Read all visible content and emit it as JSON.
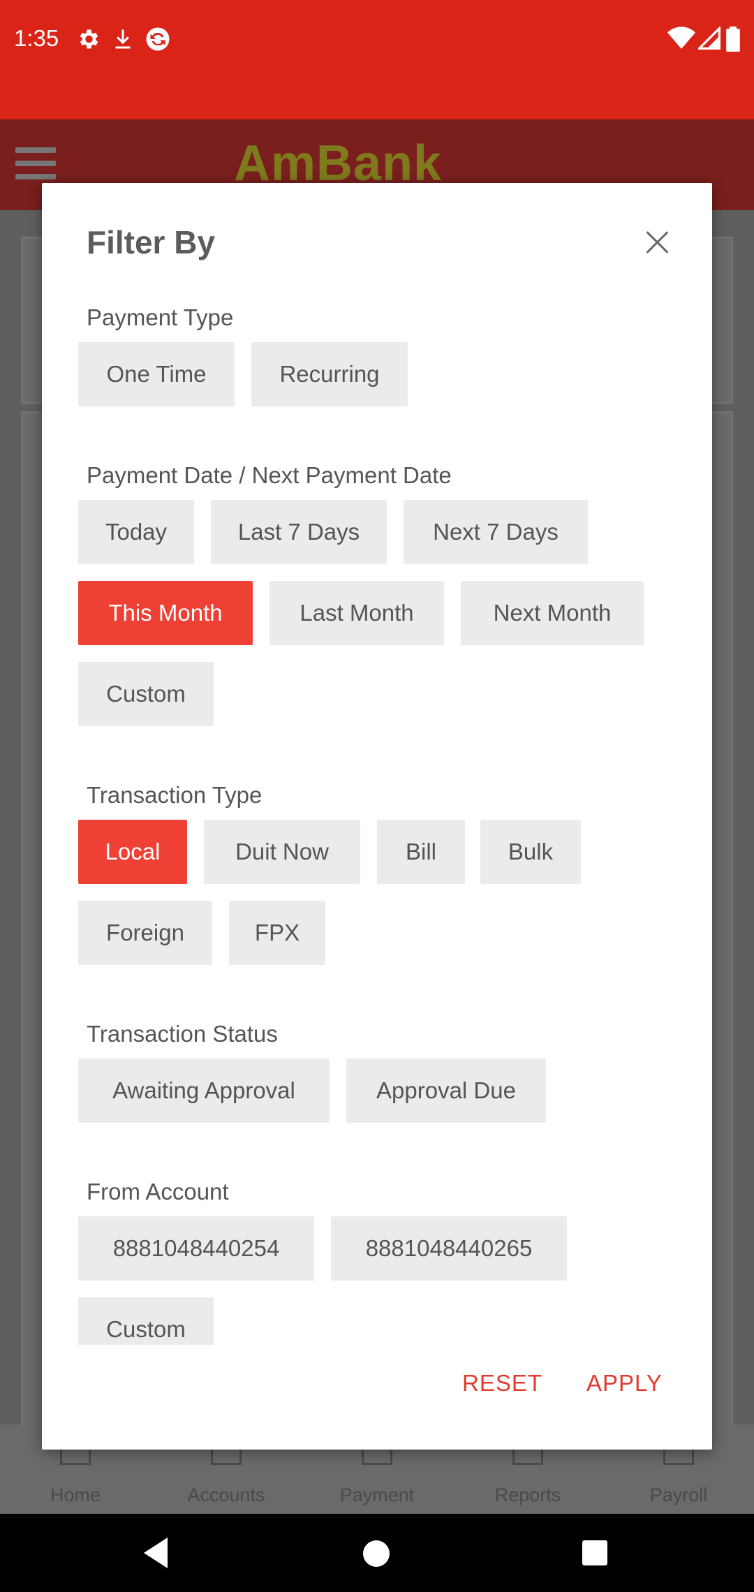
{
  "status_bar": {
    "time": "1:35",
    "icons": [
      "gear-icon",
      "download-icon",
      "sync-icon"
    ],
    "right_icons": [
      "wifi-icon",
      "signal-icon",
      "battery-icon"
    ]
  },
  "app_bar": {
    "logo_text": "AmBank"
  },
  "bottom_nav": {
    "items": [
      {
        "label": "Home",
        "icon": "home-icon"
      },
      {
        "label": "Accounts",
        "icon": "accounts-icon"
      },
      {
        "label": "Payment",
        "icon": "payment-icon"
      },
      {
        "label": "Reports",
        "icon": "reports-icon"
      },
      {
        "label": "Payroll",
        "icon": "payroll-icon"
      }
    ]
  },
  "dialog": {
    "title": "Filter By",
    "sections": {
      "payment_type": {
        "label": "Payment Type",
        "options": [
          "One Time",
          "Recurring"
        ]
      },
      "payment_date": {
        "label": "Payment Date / Next Payment Date",
        "options": [
          "Today",
          "Last 7 Days",
          "Next 7 Days",
          "This Month",
          "Last Month",
          "Next Month",
          "Custom"
        ],
        "selected": "This Month"
      },
      "transaction_type": {
        "label": "Transaction Type",
        "options": [
          "Local",
          "Duit Now",
          "Bill",
          "Bulk",
          "Foreign",
          "FPX"
        ],
        "selected": "Local"
      },
      "transaction_status": {
        "label": "Transaction Status",
        "options": [
          "Awaiting Approval",
          "Approval Due"
        ]
      },
      "from_account": {
        "label": "From Account",
        "options": [
          "8881048440254",
          "8881048440265",
          "Custom"
        ]
      }
    },
    "actions": {
      "reset": "RESET",
      "apply": "APPLY"
    }
  },
  "colors": {
    "status_bar": "#d92417",
    "accent": "#ee4035",
    "action_text": "#e23b2e",
    "chip_bg": "#ebebed"
  }
}
